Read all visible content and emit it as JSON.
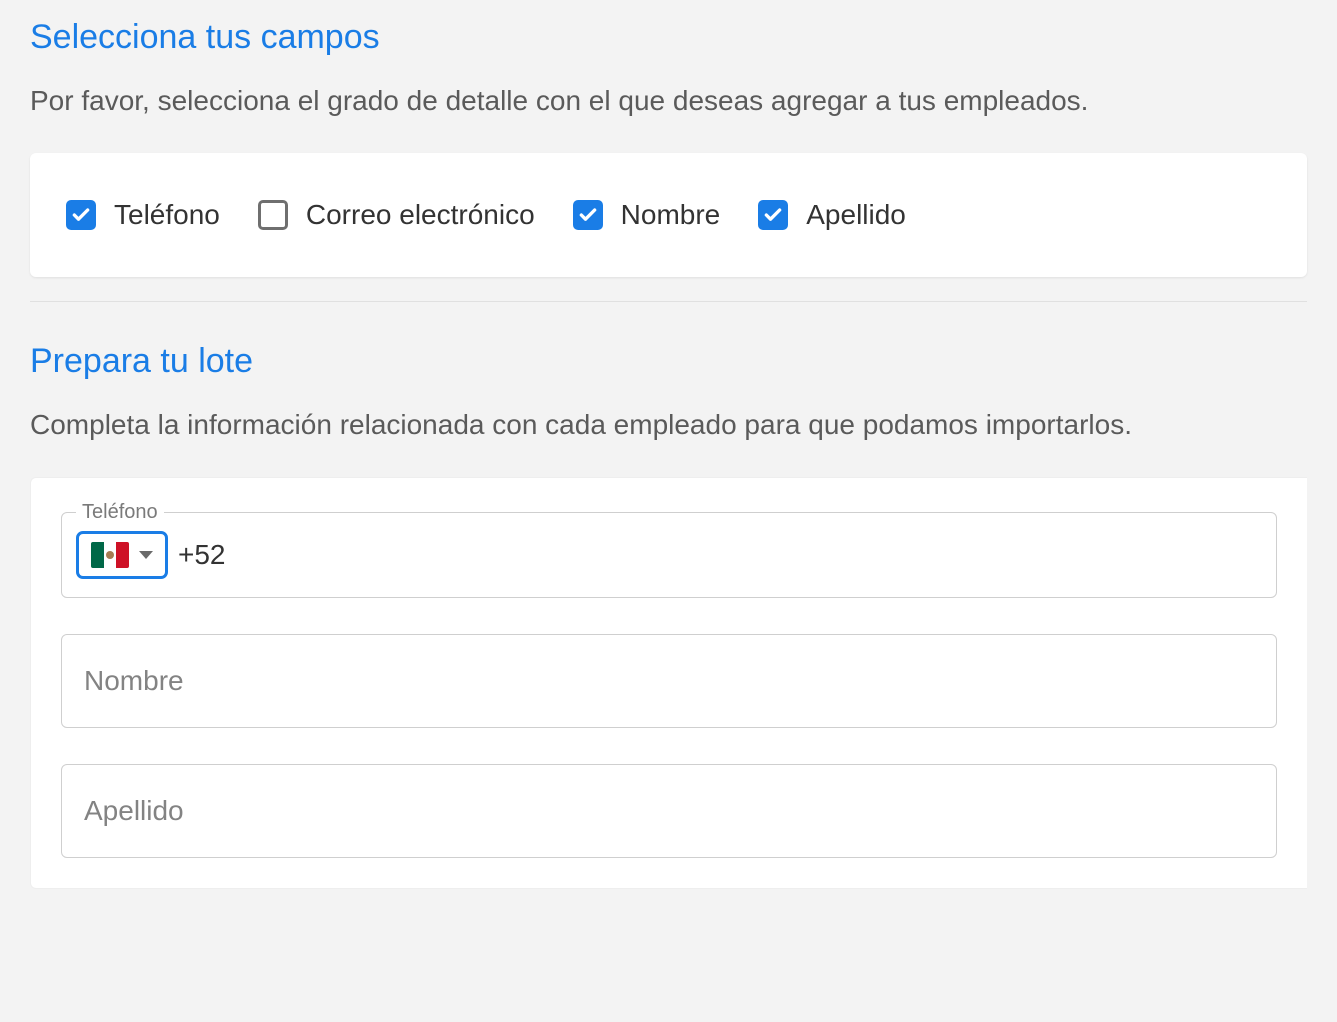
{
  "section1": {
    "title": "Selecciona tus campos",
    "description": "Por favor, selecciona el grado de detalle con el que deseas agregar a tus empleados.",
    "fields": [
      {
        "label": "Teléfono",
        "checked": true
      },
      {
        "label": "Correo electrónico",
        "checked": false
      },
      {
        "label": "Nombre",
        "checked": true
      },
      {
        "label": "Apellido",
        "checked": true
      }
    ]
  },
  "section2": {
    "title": "Prepara tu lote",
    "description": "Completa la información relacionada con cada empleado para que podamos importarlos.",
    "phone": {
      "label": "Teléfono",
      "dial_code": "+52",
      "country": "mexico"
    },
    "first_name": {
      "placeholder": "Nombre",
      "value": ""
    },
    "last_name": {
      "placeholder": "Apellido",
      "value": ""
    }
  }
}
